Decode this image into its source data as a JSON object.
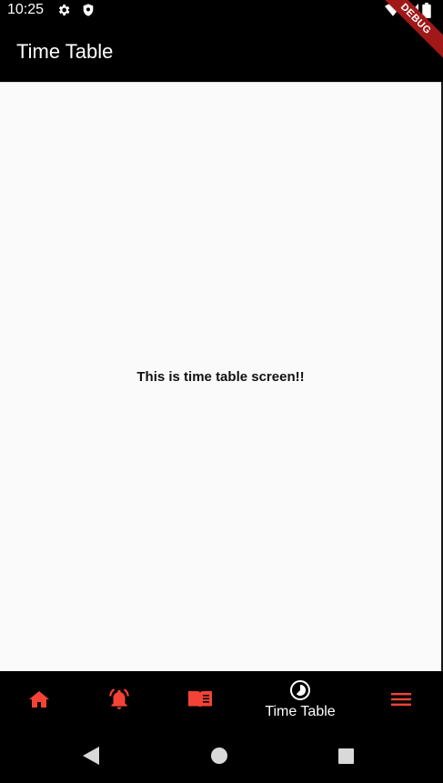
{
  "status_bar": {
    "time": "10:25",
    "left_icons": [
      "gear-icon",
      "shield-icon"
    ],
    "right_icons": [
      "wifi-icon",
      "signal-icon",
      "battery-icon"
    ]
  },
  "app_bar": {
    "title": "Time Table"
  },
  "debug_banner": {
    "label": "DEBUG"
  },
  "content": {
    "message": "This is time table screen!!"
  },
  "bottom_nav": {
    "accent_color": "#f44336",
    "selected_color": "#ffffff",
    "items": [
      {
        "icon": "home-icon",
        "label": "",
        "selected": false
      },
      {
        "icon": "bell-icon",
        "label": "",
        "selected": false
      },
      {
        "icon": "book-icon",
        "label": "",
        "selected": false
      },
      {
        "icon": "timelapse-icon",
        "label": "Time Table",
        "selected": true
      },
      {
        "icon": "menu-icon",
        "label": "",
        "selected": false
      }
    ]
  },
  "system_nav": {
    "buttons": [
      "back-icon",
      "home-circle-icon",
      "recents-icon"
    ]
  }
}
